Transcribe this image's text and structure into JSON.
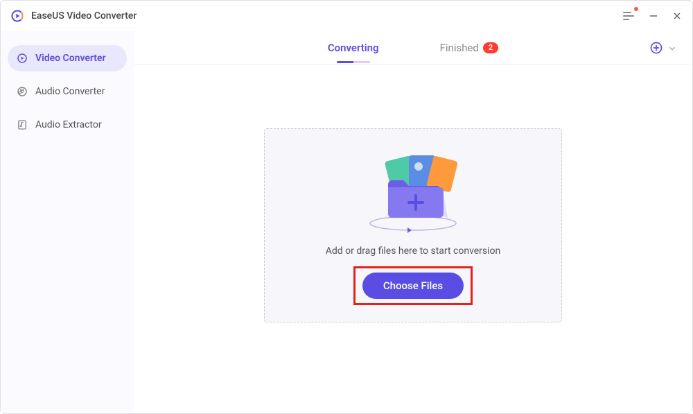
{
  "titlebar": {
    "title": "EaseUS Video Converter"
  },
  "sidebar": {
    "items": [
      {
        "label": "Video Converter",
        "active": true
      },
      {
        "label": "Audio Converter",
        "active": false
      },
      {
        "label": "Audio Extractor",
        "active": false
      }
    ]
  },
  "tabs": {
    "converting_label": "Converting",
    "finished_label": "Finished",
    "finished_badge": "2"
  },
  "dropzone": {
    "hint": "Add or drag files here to start conversion",
    "button_label": "Choose Files"
  }
}
